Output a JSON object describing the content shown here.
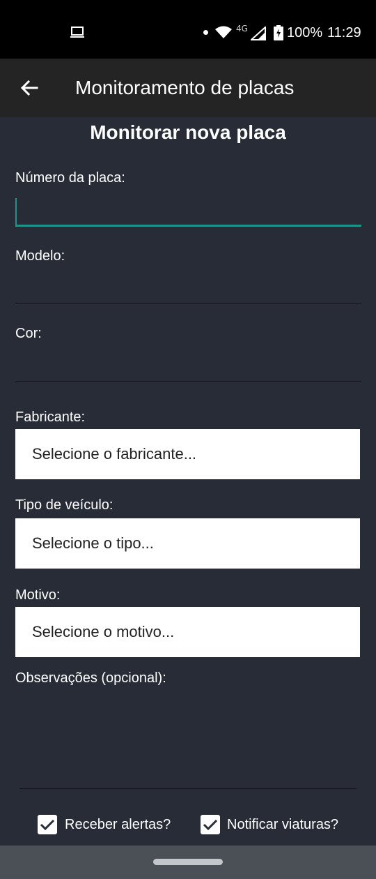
{
  "status_bar": {
    "network": "4G",
    "battery": "100%",
    "time": "11:29",
    "icons": [
      "laptop-icon",
      "notification-dot-icon",
      "wifi-icon",
      "signal-icon",
      "battery-charging-icon"
    ]
  },
  "app_bar": {
    "back_icon": "arrow-left-icon",
    "title": "Monitoramento de placas"
  },
  "form": {
    "title": "Monitorar nova placa",
    "plate": {
      "label": "Número da placa:",
      "value": ""
    },
    "model": {
      "label": "Modelo:",
      "value": ""
    },
    "color": {
      "label": "Cor:",
      "value": ""
    },
    "manufacturer": {
      "label": "Fabricante:",
      "selected": "Selecione o fabricante..."
    },
    "vehicle_type": {
      "label": "Tipo de veículo:",
      "selected": "Selecione o tipo..."
    },
    "reason": {
      "label": "Motivo:",
      "selected": "Selecione o motivo..."
    },
    "notes": {
      "label": "Observações (opcional):",
      "value": ""
    },
    "receive_alerts": {
      "label": "Receber alertas?",
      "checked": true
    },
    "notify_units": {
      "label": "Notificar viaturas?",
      "checked": true
    }
  },
  "colors": {
    "background": "#272c37",
    "app_bar": "#242424",
    "accent": "#1e9588",
    "nav_bar": "#4b5057"
  }
}
